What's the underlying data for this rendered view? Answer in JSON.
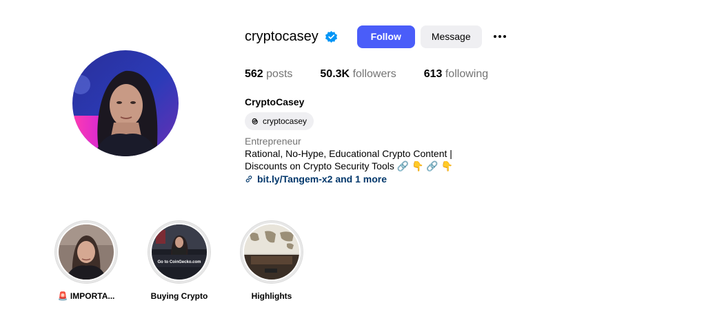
{
  "profile": {
    "username": "cryptocasey",
    "full_name": "CryptoCasey",
    "verified_icon": "verified-badge-icon",
    "threads_handle": "cryptocasey",
    "category": "Entrepreneur",
    "bio_line1": "Rational, No-Hype, Educational Crypto Content |",
    "bio_line2": "Discounts on Crypto Security Tools 🔗 👇 🔗 👇",
    "link_text": "bit.ly/Tangem-x2 and 1 more"
  },
  "actions": {
    "follow_label": "Follow",
    "message_label": "Message"
  },
  "stats": {
    "posts_count": "562",
    "posts_label": "posts",
    "followers_count": "50.3K",
    "followers_label": "followers",
    "following_count": "613",
    "following_label": "following"
  },
  "highlights": [
    {
      "label": "🚨 IMPORTA..."
    },
    {
      "label": "Buying Crypto",
      "thumb_text": "Go to CoinGecko.com"
    },
    {
      "label": "Highlights"
    }
  ],
  "colors": {
    "follow_bg": "#4a5df9",
    "verified": "#0095f6",
    "link": "#00376b",
    "muted": "#737373"
  }
}
